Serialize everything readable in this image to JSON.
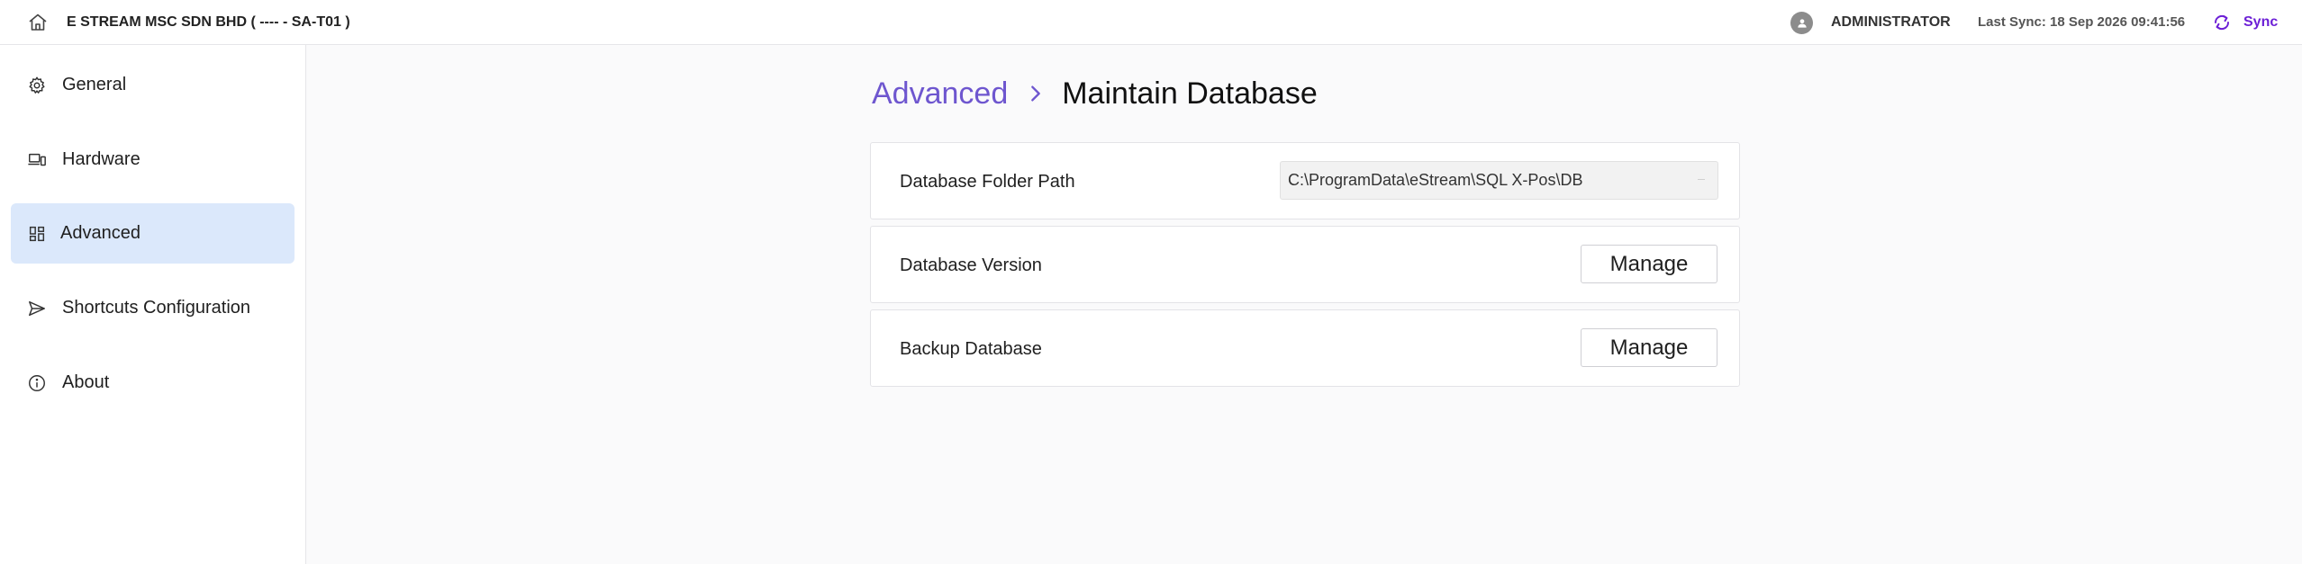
{
  "header": {
    "company": "E STREAM MSC SDN BHD ( ---- - SA-T01 )",
    "user": "ADMINISTRATOR",
    "last_sync": "Last Sync: 18 Sep 2026 09:41:56",
    "sync_label": "Sync",
    "accent_color": "#6c1fd6"
  },
  "sidebar": {
    "items": [
      {
        "label": "General",
        "icon": "gear-icon",
        "active": false
      },
      {
        "label": "Hardware",
        "icon": "devices-icon",
        "active": false
      },
      {
        "label": "Advanced",
        "icon": "dashboard-icon",
        "active": true
      },
      {
        "label": "Shortcuts Configuration",
        "icon": "send-icon",
        "active": false
      },
      {
        "label": "About",
        "icon": "info-icon",
        "active": false
      }
    ],
    "active_color": "#dbe8fb"
  },
  "main": {
    "breadcrumb": {
      "parent": "Advanced",
      "current": "Maintain Database"
    },
    "rows": [
      {
        "label": "Database Folder Path",
        "value": "C:\\ProgramData\\eStream\\SQL X-Pos\\DB"
      },
      {
        "label": "Database Version",
        "button": "Manage"
      },
      {
        "label": "Backup Database",
        "button": "Manage"
      }
    ]
  }
}
